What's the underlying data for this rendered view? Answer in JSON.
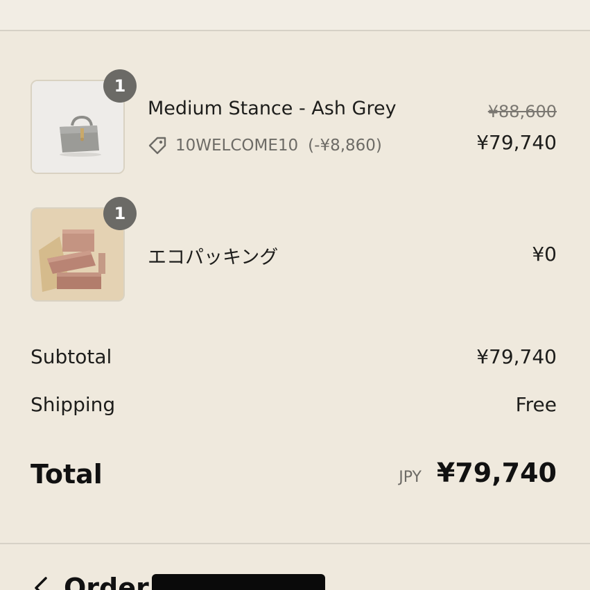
{
  "line_items": [
    {
      "quantity": "1",
      "name": "Medium Stance - Ash Grey",
      "discount_code": "10WELCOME10",
      "discount_amount": "(-¥8,860)",
      "original_price": "¥88,600",
      "price": "¥79,740",
      "thumbnail": "grey-handbag-image"
    },
    {
      "quantity": "1",
      "name": "エコパッキング",
      "price": "¥0",
      "thumbnail": "stacked-boxes-image"
    }
  ],
  "summary": {
    "subtotal_label": "Subtotal",
    "subtotal_value": "¥79,740",
    "shipping_label": "Shipping",
    "shipping_value": "Free",
    "total_label": "Total",
    "currency": "JPY",
    "total_value": "¥79,740"
  },
  "order": {
    "label": "Order"
  },
  "colors": {
    "background": "#efe9dd",
    "badge": "#6b6a66",
    "divider": "#d6d1c6"
  },
  "icons": {
    "discount": "tag-icon",
    "back": "chevron-left-icon"
  }
}
